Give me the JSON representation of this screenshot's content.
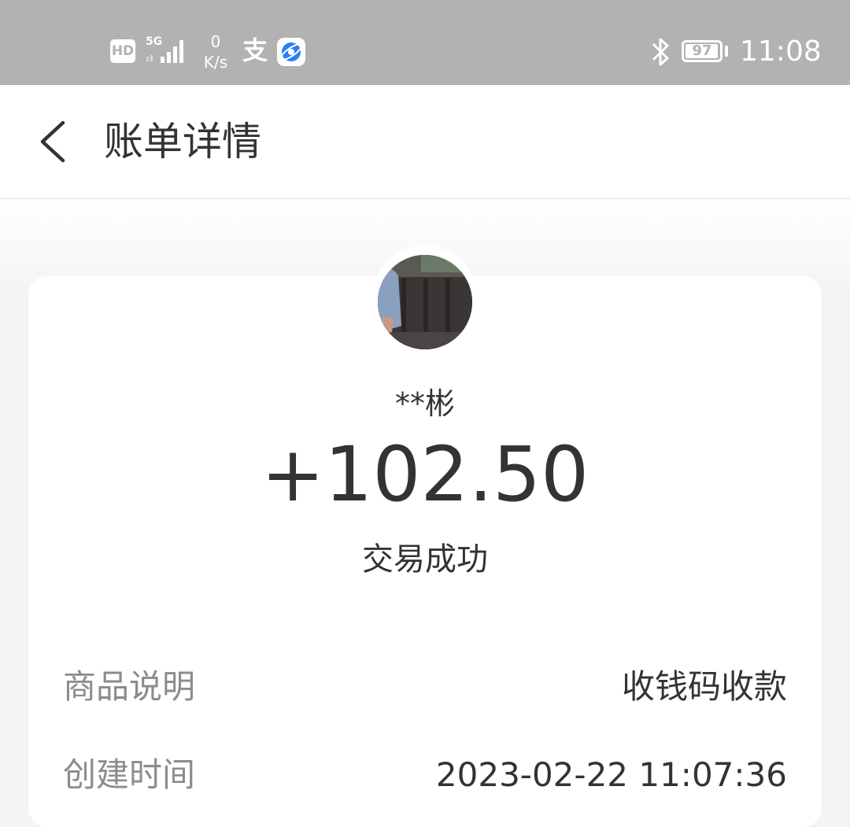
{
  "status_bar": {
    "hd_badge": "HD",
    "network_type": "5G",
    "net_speed_value": "0",
    "net_speed_unit": "K/s",
    "alipay_glyph": "支",
    "battery_level": "97",
    "battery_fraction": 0.97,
    "time": "11:08",
    "icons": [
      "hd-icon",
      "signal-icon",
      "alipay-icon",
      "browser-icon",
      "bluetooth-icon",
      "battery-icon"
    ]
  },
  "header": {
    "back_icon": "chevron-left-icon",
    "title": "账单详情"
  },
  "transaction": {
    "payer_name": "**彬",
    "amount": "+102.50",
    "status": "交易成功"
  },
  "details": [
    {
      "label": "商品说明",
      "value": "收钱码收款"
    },
    {
      "label": "创建时间",
      "value": "2023-02-22 11:07:36"
    }
  ],
  "colors": {
    "status_bar_bg": "#b2b2b2",
    "text_primary": "#333333",
    "text_secondary": "#8c8c8c",
    "page_bg": "#f4f4f4",
    "card_bg": "#ffffff",
    "browser_icon_blue": "#2d7ef7"
  }
}
